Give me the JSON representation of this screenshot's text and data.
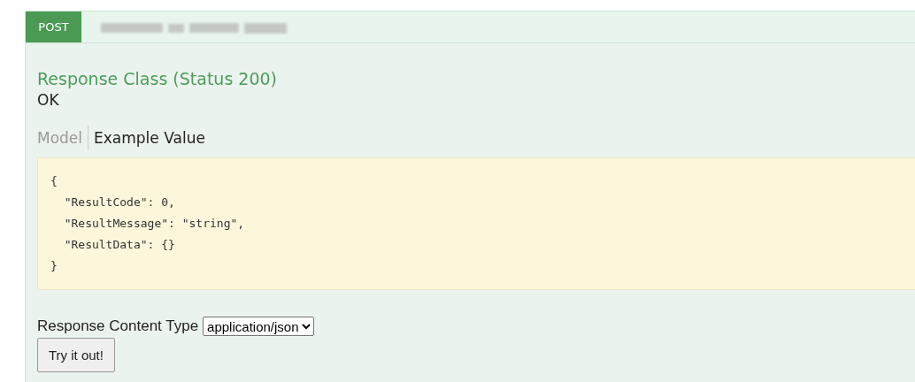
{
  "operation": {
    "method": "POST"
  },
  "response_class": {
    "heading": "Response Class (Status 200)",
    "description": "OK"
  },
  "tabs": [
    {
      "label": "Model",
      "selected": false
    },
    {
      "label": "Example Value",
      "selected": true
    }
  ],
  "example_value": [
    "{",
    "  \"ResultCode\": 0,",
    "  \"ResultMessage\": \"string\",",
    "  \"ResultData\": {}",
    "}"
  ],
  "response_content_type": {
    "label": "Response Content Type",
    "value": "application/json"
  },
  "buttons": [
    {
      "label": "Try it out!"
    }
  ]
}
